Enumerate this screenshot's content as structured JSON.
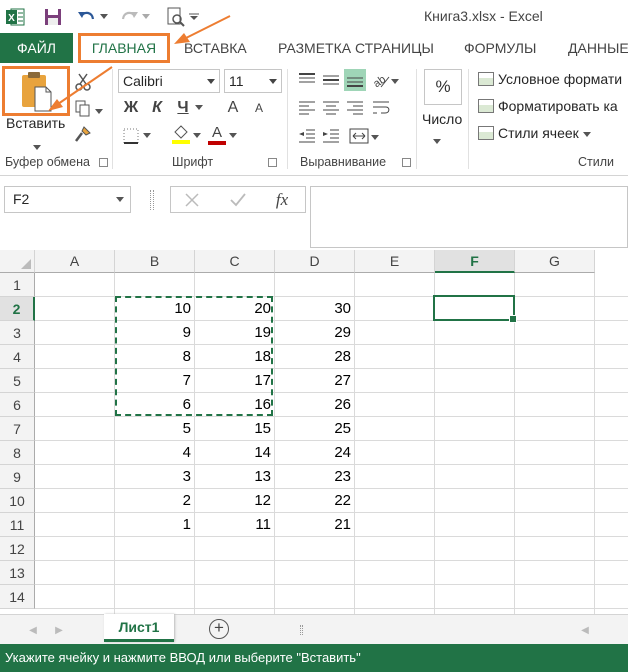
{
  "window": {
    "title": "Книга3.xlsx - Excel"
  },
  "ribbon_tabs": [
    {
      "label": "ФАЙЛ"
    },
    {
      "label": "ГЛАВНАЯ"
    },
    {
      "label": "ВСТАВКА"
    },
    {
      "label": "РАЗМЕТКА СТРАНИЦЫ"
    },
    {
      "label": "ФОРМУЛЫ"
    },
    {
      "label": "ДАННЫЕ"
    }
  ],
  "clipboard": {
    "paste_label": "Вставить",
    "group_label": "Буфер обмена"
  },
  "font": {
    "name": "Calibri",
    "size": "11",
    "bold": "Ж",
    "italic": "К",
    "underline": "Ч",
    "grow": "A",
    "shrink": "A",
    "color_letter": "A",
    "group_label": "Шрифт"
  },
  "alignment": {
    "group_label": "Выравнивание"
  },
  "number": {
    "percent": "%",
    "label": "Число"
  },
  "styles": {
    "conditional": "Условное формати",
    "format_table": "Форматировать ка",
    "cell_styles": "Стили ячеек",
    "group_label": "Стили"
  },
  "formula_bar": {
    "name_box": "F2",
    "fx": "fx",
    "value": ""
  },
  "grid": {
    "columns": [
      "A",
      "B",
      "C",
      "D",
      "E",
      "F",
      "G"
    ],
    "rows": [
      "1",
      "2",
      "3",
      "4",
      "5",
      "6",
      "7",
      "8",
      "9",
      "10",
      "11",
      "12",
      "13",
      "14"
    ],
    "active_column": "F",
    "active_row": "2",
    "column_B": [
      "10",
      "9",
      "8",
      "7",
      "6",
      "5",
      "4",
      "3",
      "2",
      "1"
    ],
    "column_C": [
      "20",
      "19",
      "18",
      "17",
      "16",
      "15",
      "14",
      "13",
      "12",
      "11"
    ],
    "column_D": [
      "30",
      "29",
      "28",
      "27",
      "26",
      "25",
      "24",
      "23",
      "22",
      "21"
    ]
  },
  "sheets": {
    "active": "Лист1",
    "add": "+"
  },
  "status": {
    "message": "Укажите ячейку и нажмите ВВОД или выберите \"Вставить\""
  },
  "colors": {
    "excel_green": "#217346",
    "highlight_orange": "#ed7d31"
  }
}
